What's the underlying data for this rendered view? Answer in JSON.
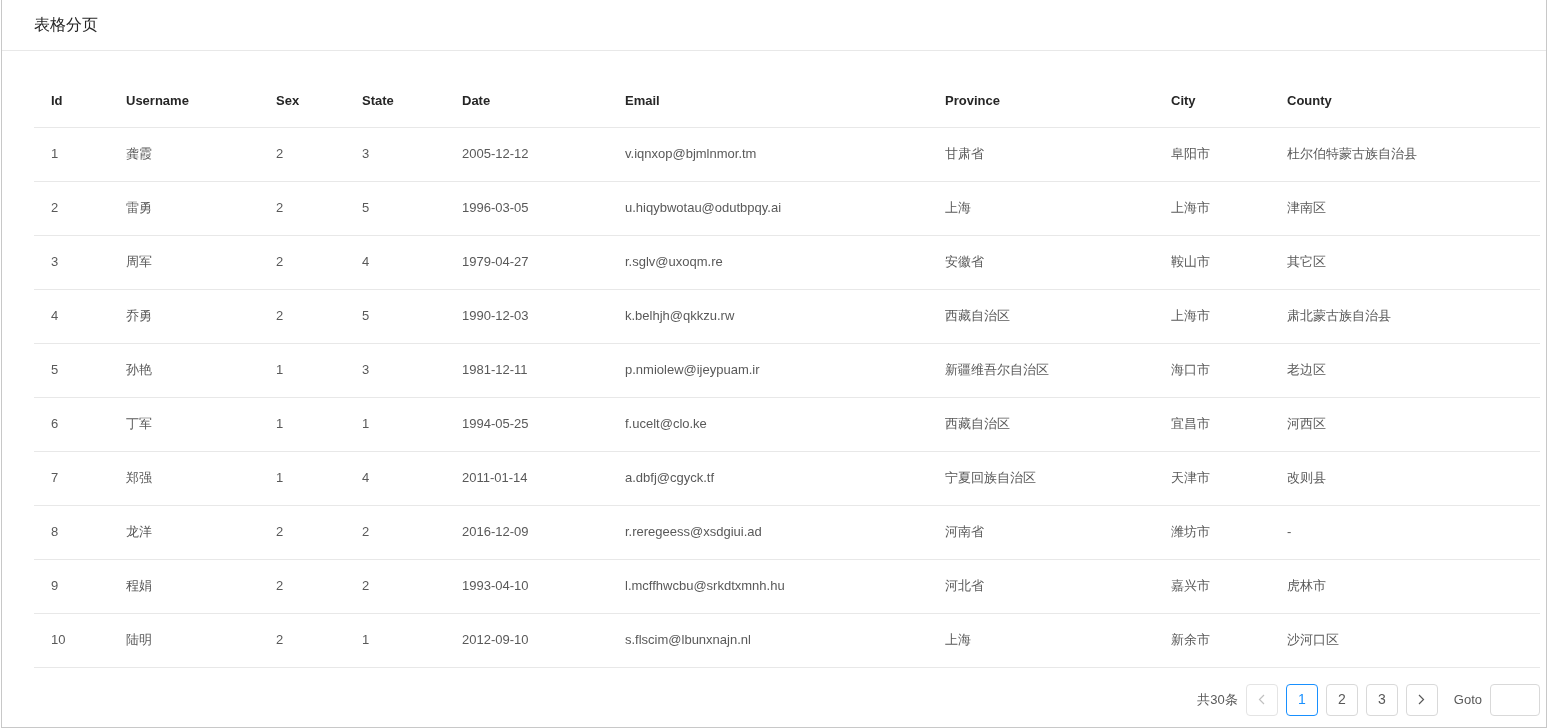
{
  "title": "表格分页",
  "table": {
    "columns": [
      "Id",
      "Username",
      "Sex",
      "State",
      "Date",
      "Email",
      "Province",
      "City",
      "County"
    ],
    "rows": [
      [
        "1",
        "龚霞",
        "2",
        "3",
        "2005-12-12",
        "v.iqnxop@bjmlnmor.tm",
        "甘肃省",
        "阜阳市",
        "杜尔伯特蒙古族自治县"
      ],
      [
        "2",
        "雷勇",
        "2",
        "5",
        "1996-03-05",
        "u.hiqybwotau@odutbpqy.ai",
        "上海",
        "上海市",
        "津南区"
      ],
      [
        "3",
        "周军",
        "2",
        "4",
        "1979-04-27",
        "r.sglv@uxoqm.re",
        "安徽省",
        "鞍山市",
        "其它区"
      ],
      [
        "4",
        "乔勇",
        "2",
        "5",
        "1990-12-03",
        "k.belhjh@qkkzu.rw",
        "西藏自治区",
        "上海市",
        "肃北蒙古族自治县"
      ],
      [
        "5",
        "孙艳",
        "1",
        "3",
        "1981-12-11",
        "p.nmiolew@ijeypuam.ir",
        "新疆维吾尔自治区",
        "海口市",
        "老边区"
      ],
      [
        "6",
        "丁军",
        "1",
        "1",
        "1994-05-25",
        "f.ucelt@clo.ke",
        "西藏自治区",
        "宜昌市",
        "河西区"
      ],
      [
        "7",
        "郑强",
        "1",
        "4",
        "2011-01-14",
        "a.dbfj@cgyck.tf",
        "宁夏回族自治区",
        "天津市",
        "改则县"
      ],
      [
        "8",
        "龙洋",
        "2",
        "2",
        "2016-12-09",
        "r.reregeess@xsdgiui.ad",
        "河南省",
        "潍坊市",
        "-"
      ],
      [
        "9",
        "程娟",
        "2",
        "2",
        "1993-04-10",
        "l.mcffhwcbu@srkdtxmnh.hu",
        "河北省",
        "嘉兴市",
        "虎林市"
      ],
      [
        "10",
        "陆明",
        "2",
        "1",
        "2012-09-10",
        "s.flscim@lbunxnajn.nl",
        "上海",
        "新余市",
        "沙河口区"
      ]
    ]
  },
  "pagination": {
    "total": "共30条",
    "prev": {
      "disabled": true
    },
    "pages": [
      {
        "label": "1",
        "selected": true
      },
      {
        "label": "2",
        "selected": false
      },
      {
        "label": "3",
        "selected": false
      }
    ],
    "next": {
      "disabled": false
    },
    "goto_label": "Goto"
  }
}
